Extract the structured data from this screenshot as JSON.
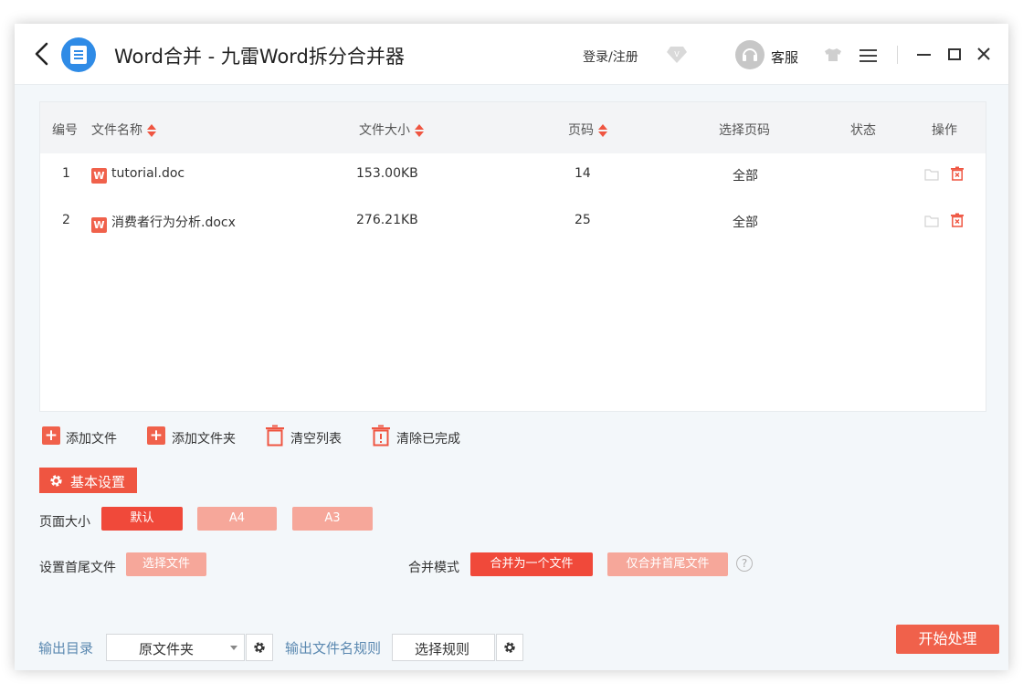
{
  "titlebar": {
    "title": "Word合并 - 九雷Word拆分合并器",
    "login": "登录/注册",
    "service": "客服"
  },
  "table": {
    "headers": {
      "index": "编号",
      "name": "文件名称",
      "size": "文件大小",
      "pages": "页码",
      "select_pages": "选择页码",
      "status": "状态",
      "actions": "操作"
    },
    "rows": [
      {
        "index": "1",
        "name": "tutorial.doc",
        "size": "153.00KB",
        "pages": "14",
        "select_pages": "全部",
        "status": ""
      },
      {
        "index": "2",
        "name": "消费者行为分析.docx",
        "size": "276.21KB",
        "pages": "25",
        "select_pages": "全部",
        "status": ""
      }
    ],
    "file_icon_letter": "W"
  },
  "toolbar": {
    "add_file": "添加文件",
    "add_folder": "添加文件夹",
    "clear_list": "清空列表",
    "clear_done": "清除已完成"
  },
  "settings": {
    "tab_label": "基本设置",
    "page_size_label": "页面大小",
    "page_size_options": [
      "默认",
      "A4",
      "A3"
    ],
    "page_size_selected": "默认",
    "head_tail_label": "设置首尾文件",
    "choose_file": "选择文件",
    "merge_mode_label": "合并模式",
    "merge_mode_options": [
      "合并为一个文件",
      "仅合并首尾文件"
    ],
    "merge_mode_selected": "合并为一个文件",
    "help_symbol": "?"
  },
  "output": {
    "dir_label": "输出目录",
    "dir_value": "原文件夹",
    "name_rule_label": "输出文件名规则",
    "rule_button": "选择规则",
    "start_button": "开始处理"
  },
  "colors": {
    "accent": "#f0493a",
    "accent_light": "#f6a79a",
    "link_blue": "#5a88b0",
    "logo_blue": "#2f8be6"
  },
  "icons": [
    "back-icon",
    "app-logo-icon",
    "vip-diamond-icon",
    "service-avatar-icon",
    "skin-shirt-icon",
    "menu-icon",
    "minimize-icon",
    "maximize-icon",
    "close-icon",
    "sort-icon",
    "word-file-icon",
    "folder-icon",
    "trash-icon",
    "plus-icon",
    "gear-icon",
    "help-icon",
    "caret-down-icon"
  ]
}
